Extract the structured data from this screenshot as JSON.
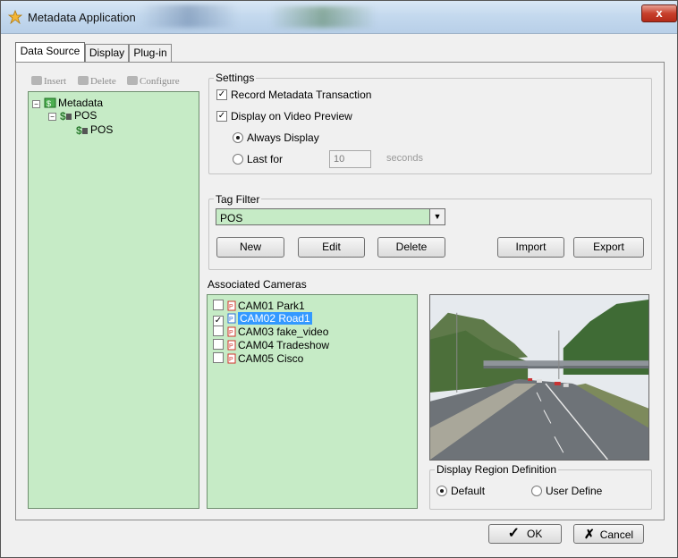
{
  "window": {
    "title": "Metadata Application",
    "close_label": "x"
  },
  "tabs": [
    {
      "label": "Data Source",
      "active": true
    },
    {
      "label": "Display",
      "active": false
    },
    {
      "label": "Plug-in",
      "active": false
    }
  ],
  "toolbar": {
    "insert": "Insert",
    "delete": "Delete",
    "configure": "Configure"
  },
  "tree": {
    "root": "Metadata",
    "child": "POS",
    "leaf": "POS"
  },
  "settings": {
    "group_title": "Settings",
    "record_label": "Record Metadata Transaction",
    "record_checked": true,
    "display_preview_label": "Display on Video Preview",
    "display_preview_checked": true,
    "always_display_label": "Always Display",
    "always_display_selected": true,
    "last_for_label": "Last for",
    "last_for_value": "10",
    "seconds_label": "seconds"
  },
  "tag_filter": {
    "group_title": "Tag Filter",
    "selected": "POS",
    "new_label": "New",
    "edit_label": "Edit",
    "delete_label": "Delete",
    "import_label": "Import",
    "export_label": "Export"
  },
  "cameras": {
    "title": "Associated Cameras",
    "items": [
      {
        "label": "CAM01 Park1",
        "checked": false,
        "selected": false
      },
      {
        "label": "CAM02 Road1",
        "checked": true,
        "selected": true
      },
      {
        "label": "CAM03 fake_video",
        "checked": false,
        "selected": false
      },
      {
        "label": "CAM04 Tradeshow",
        "checked": false,
        "selected": false
      },
      {
        "label": "CAM05 Cisco",
        "checked": false,
        "selected": false
      }
    ]
  },
  "region": {
    "group_title": "Display Region Definition",
    "default_label": "Default",
    "default_selected": true,
    "user_define_label": "User Define"
  },
  "footer": {
    "ok_label": "OK",
    "cancel_label": "Cancel"
  },
  "colors": {
    "list_bg": "#c6ebc6",
    "selection": "#3399ff",
    "close_button": "#c7402c"
  }
}
